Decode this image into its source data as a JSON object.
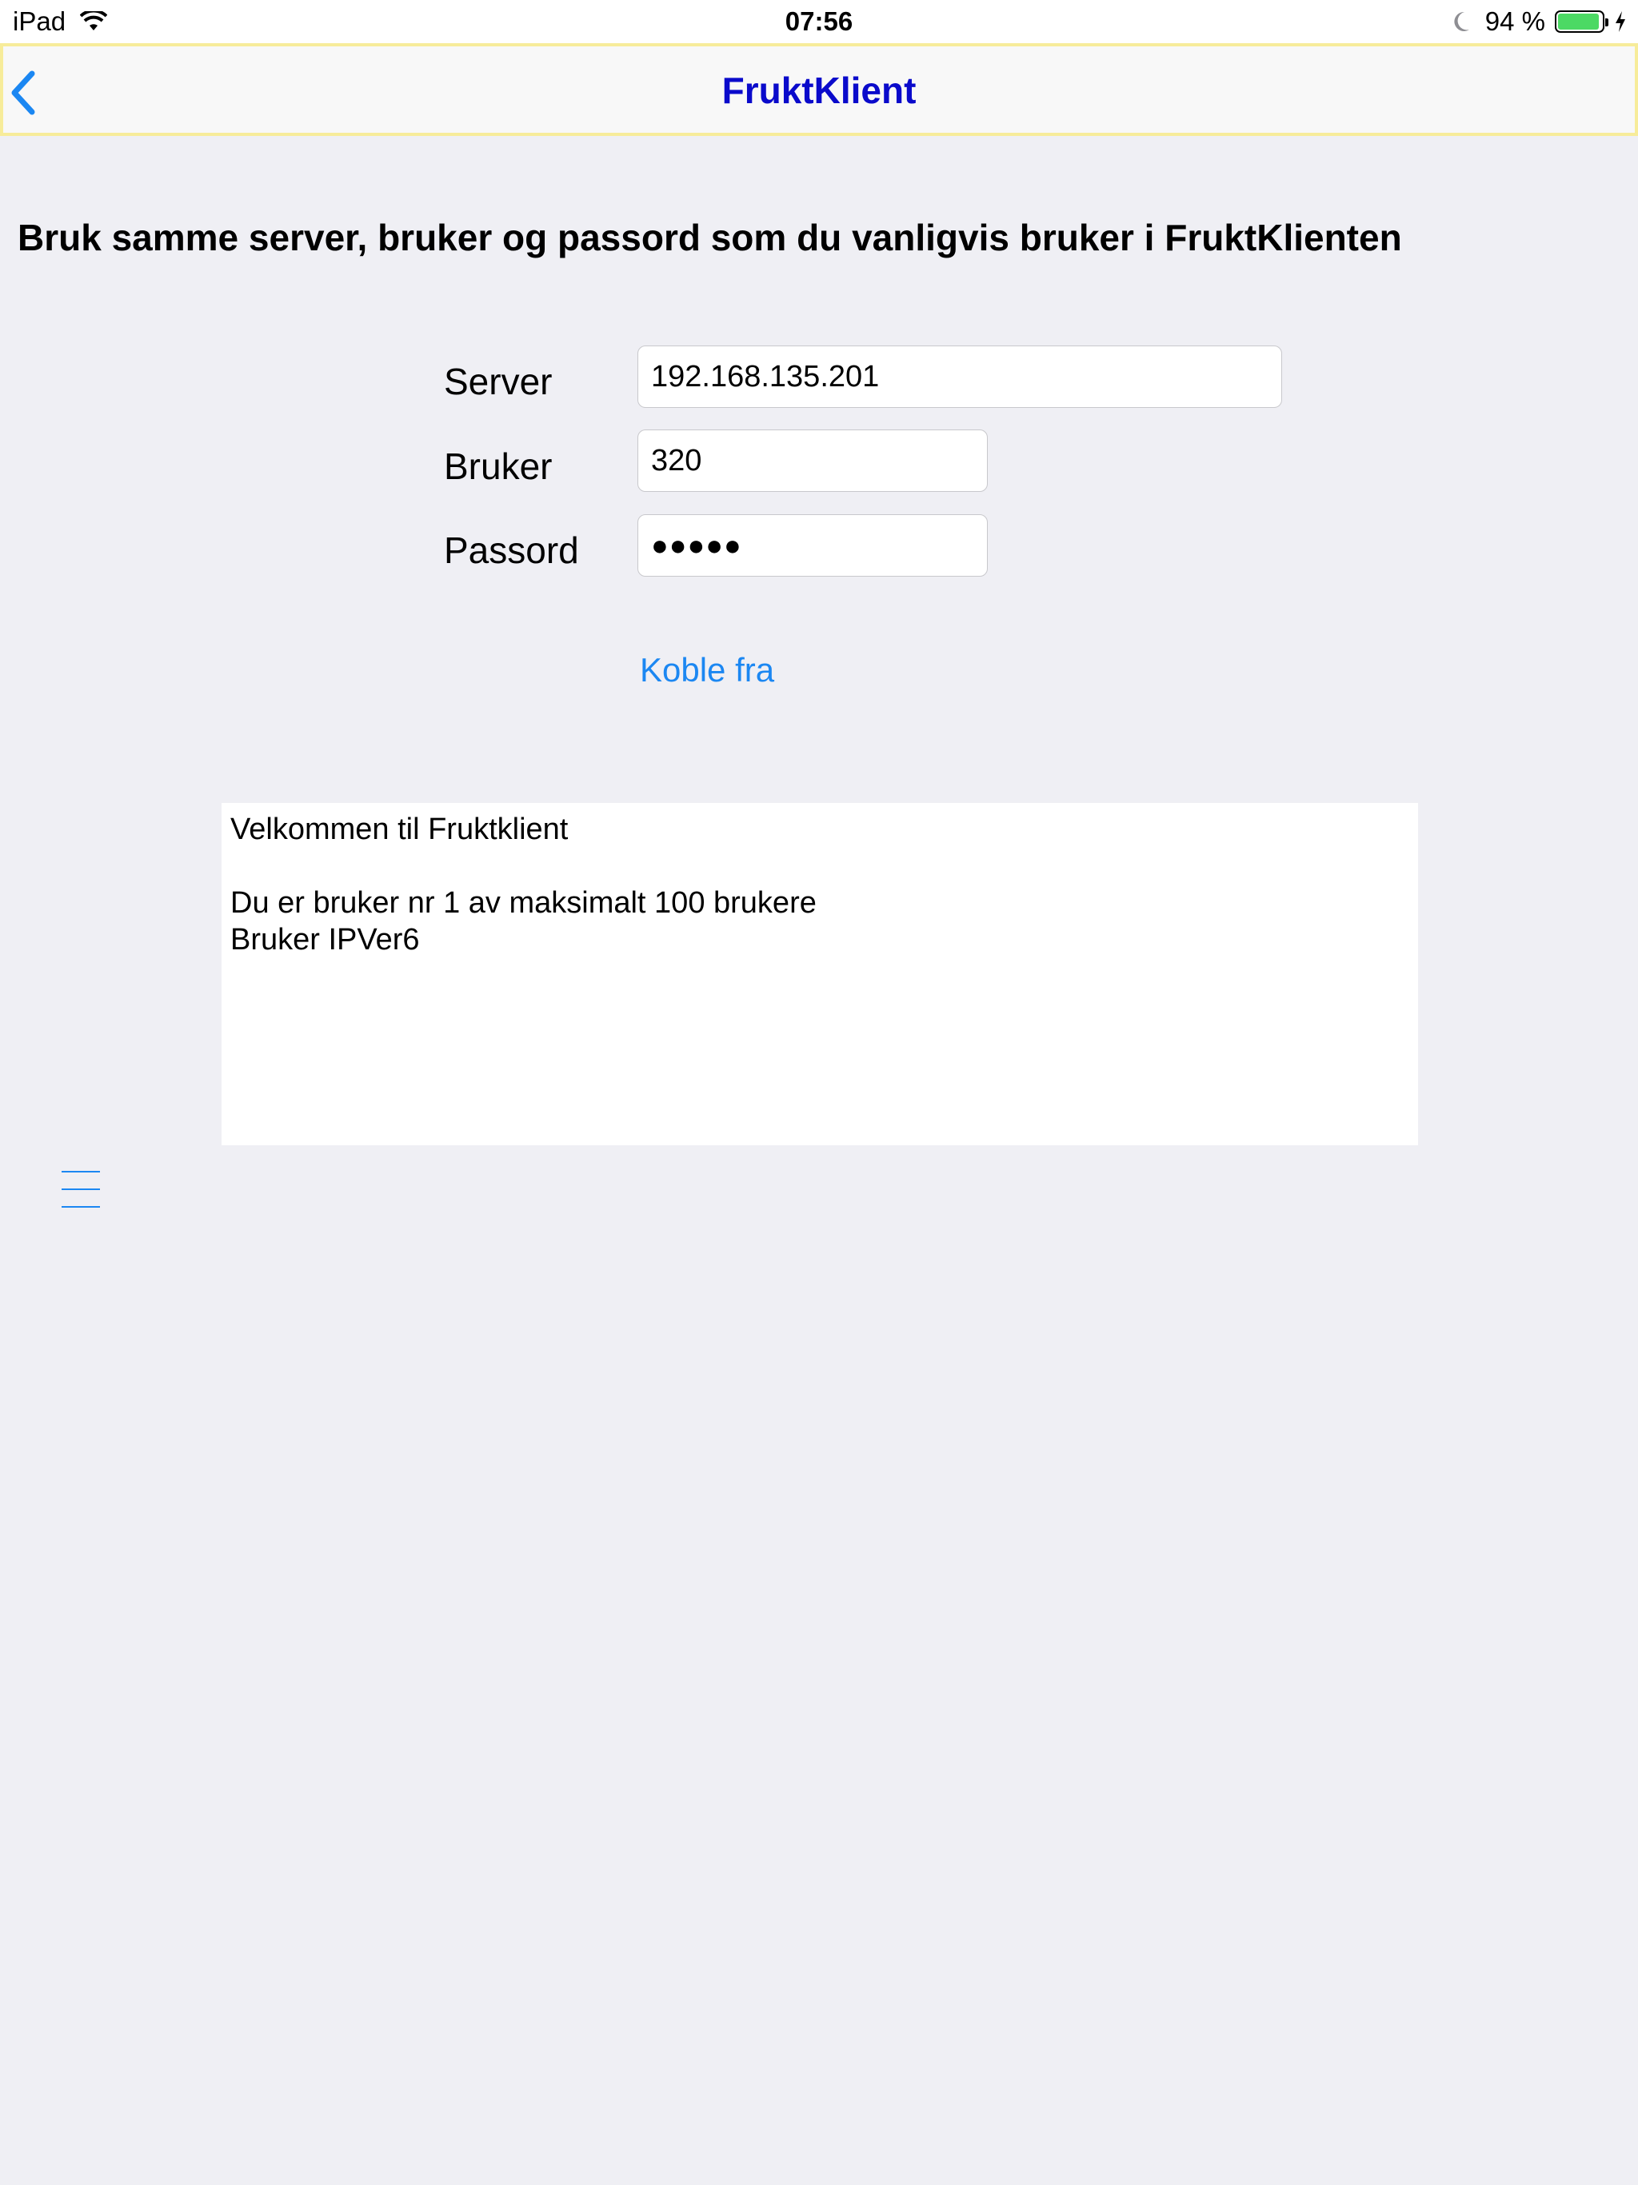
{
  "status_bar": {
    "device": "iPad",
    "time": "07:56",
    "battery_percent": "94 %",
    "battery_level": 0.94
  },
  "nav": {
    "title": "FruktKlient"
  },
  "heading": "Bruk samme server, bruker og passord som du vanligvis bruker i FruktKlienten",
  "form": {
    "server_label": "Server",
    "server_value": "192.168.135.201",
    "user_label": "Bruker",
    "user_value": "320",
    "password_label": "Passord",
    "password_mask": "●●●●●"
  },
  "disconnect_label": "Koble fra",
  "messages": [
    "Velkommen til Fruktklient",
    "",
    "Du er bruker nr 1 av maksimalt 100 brukere",
    "Bruker IPVer6"
  ],
  "icons": {
    "wifi": "wifi-icon",
    "moon": "moon-icon",
    "battery": "battery-icon",
    "charging": "bolt-icon",
    "back": "chevron-left-icon",
    "menu": "menu-icon"
  },
  "colors": {
    "background": "#efeff4",
    "nav_title": "#0a0acb",
    "nav_border": "#f7ec9a",
    "tint": "#1b87f2",
    "battery": "#4cd964"
  }
}
